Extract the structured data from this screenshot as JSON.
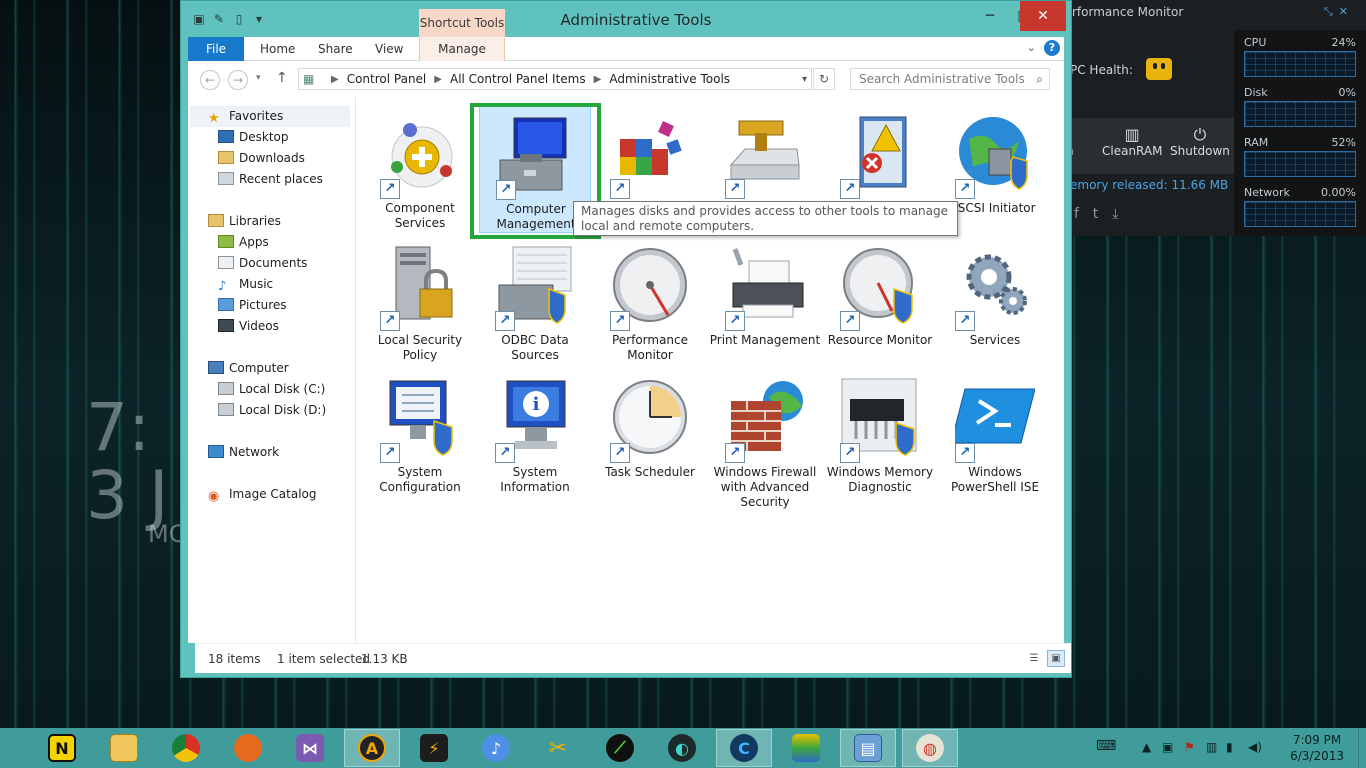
{
  "window": {
    "title": "Administrative Tools",
    "context_tab": "Shortcut Tools",
    "minimize": "─",
    "maximize": "□",
    "close": "✕"
  },
  "ribbon": {
    "tabs": [
      "File",
      "Home",
      "Share",
      "View",
      "Manage"
    ],
    "help": "?"
  },
  "address": {
    "crumbs": [
      "Control Panel",
      "All Control Panel Items",
      "Administrative Tools"
    ],
    "search_placeholder": "Search Administrative Tools"
  },
  "nav": {
    "favorites": "Favorites",
    "favorites_items": [
      "Desktop",
      "Downloads",
      "Recent places"
    ],
    "libraries": "Libraries",
    "libraries_items": [
      "Apps",
      "Documents",
      "Music",
      "Pictures",
      "Videos"
    ],
    "computer": "Computer",
    "computer_items": [
      "Local Disk (C:)",
      "Local Disk (D:)"
    ],
    "network": "Network",
    "image_catalog": "Image Catalog"
  },
  "files": [
    {
      "label": "Component Services"
    },
    {
      "label": "Computer Management"
    },
    {
      "label": ""
    },
    {
      "label": ""
    },
    {
      "label": ""
    },
    {
      "label": "iSCSI Initiator"
    },
    {
      "label": "Local Security Policy"
    },
    {
      "label": "ODBC Data Sources"
    },
    {
      "label": "Performance Monitor"
    },
    {
      "label": "Print Management"
    },
    {
      "label": "Resource Monitor"
    },
    {
      "label": "Services"
    },
    {
      "label": "System Configuration"
    },
    {
      "label": "System Information"
    },
    {
      "label": "Task Scheduler"
    },
    {
      "label": "Windows Firewall with Advanced Security"
    },
    {
      "label": "Windows Memory Diagnostic"
    },
    {
      "label": "Windows PowerShell ISE"
    }
  ],
  "tooltip": "Manages disks and provides access to other tools to manage local and remote computers.",
  "status": {
    "items": "18 items",
    "selected": "1 item selected",
    "size": "1.13 KB"
  },
  "gadget": {
    "title": "rformance Monitor",
    "pc_health": "PC Health:",
    "tool_partial": "n",
    "clean_ram": "CleanRAM",
    "shutdown": "Shutdown",
    "memory_released": "emory released: 11.66 MB",
    "meters": [
      {
        "label": "CPU",
        "value": "24%"
      },
      {
        "label": "Disk",
        "value": "0%"
      },
      {
        "label": "RAM",
        "value": "52%"
      },
      {
        "label": "Network",
        "value": "0.00%"
      }
    ]
  },
  "desktop_clock": {
    "time": "7:",
    "date": "3 J",
    "month": "MC"
  },
  "taskbar": {
    "clock_time": "7:09 PM",
    "clock_date": "6/3/2013"
  }
}
